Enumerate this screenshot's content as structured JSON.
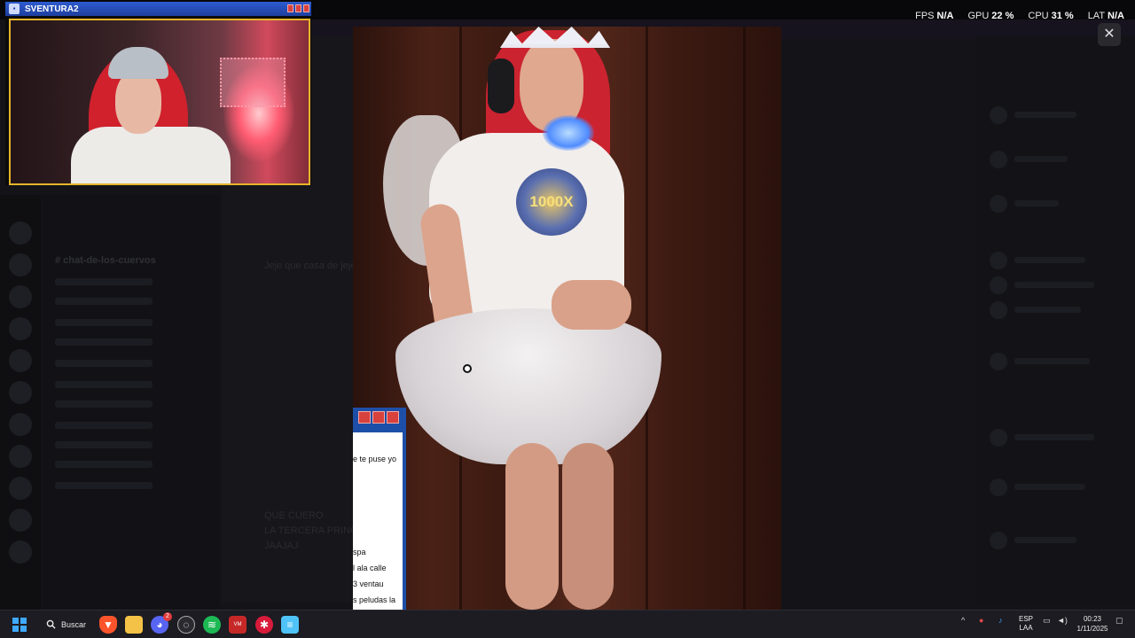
{
  "overlay": {
    "fps_label": "FPS",
    "fps_value": "N/A",
    "gpu_label": "GPU",
    "gpu_value": "22 %",
    "cpu_label": "CPU",
    "cpu_value": "31 %",
    "lat_label": "LAT",
    "lat_value": "N/A"
  },
  "cam_window": {
    "title": "SVENTURA2"
  },
  "image_viewer": {
    "close_glyph": "✕",
    "badge_text": "1000X"
  },
  "background_discord": {
    "channel_title": "# chat-de-los-cuervos",
    "chat_text": "Jeje que casa de jeje",
    "messages": [
      "QUE CUERO",
      "LA TERCERA PRINC",
      "JAAJAJ"
    ]
  },
  "chat_popup": {
    "lines": [
      "e te puse yo",
      "spa",
      "l ala calle",
      "3 ventau",
      "s peludas la"
    ]
  },
  "taskbar": {
    "search_label": "Buscar",
    "discord_badge": "2",
    "lang_top": "ESP",
    "lang_bottom": "LAA",
    "time": "00:23",
    "date": "1/11/2025"
  },
  "icons": {
    "start": "windows-start-icon",
    "search": "search-icon",
    "brave": "brave-browser-icon",
    "folder": "file-explorer-icon",
    "discord": "discord-icon",
    "obs": "obs-studio-icon",
    "spotify": "spotify-icon",
    "voicemeeter": "voicemeeter-icon",
    "app7": "streamlabs-icon",
    "notepad": "notepad-icon"
  },
  "colors": {
    "accent_cam_border": "#e6b52a",
    "cam_titlebar": "#2d5bd0",
    "spotify": "#1db954",
    "discord": "#5865f2",
    "brave": "#fb542b"
  }
}
